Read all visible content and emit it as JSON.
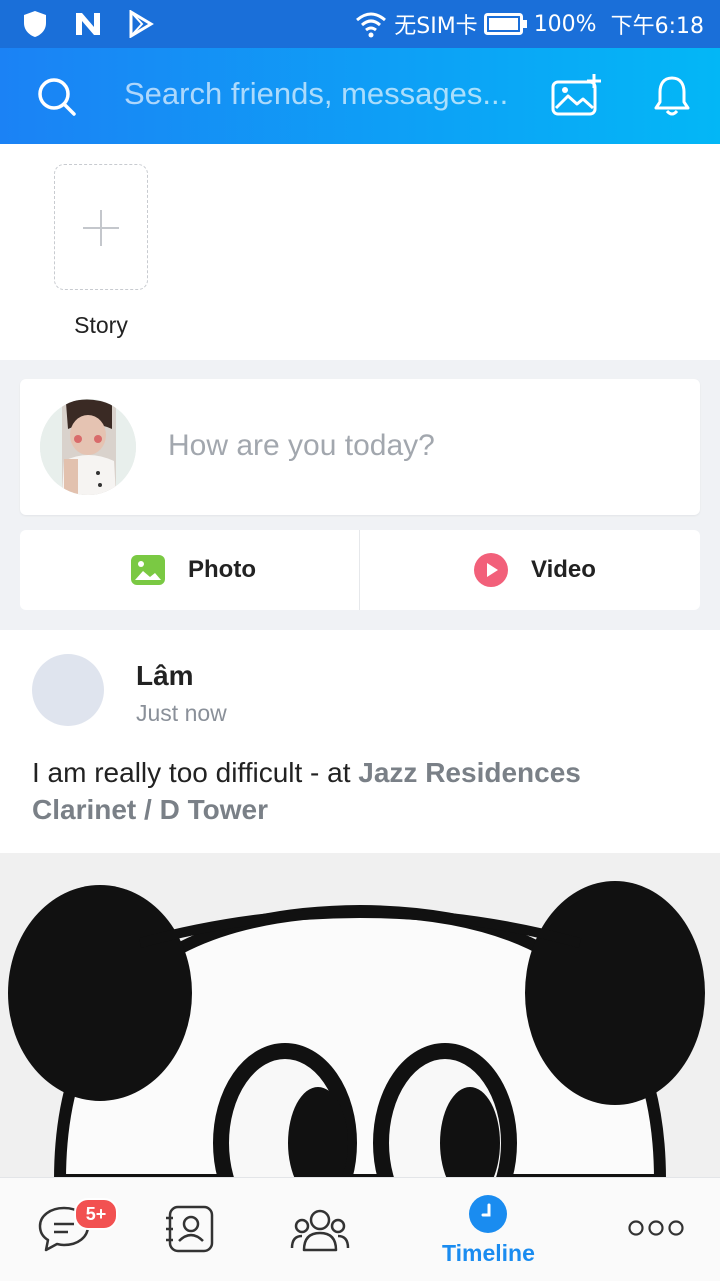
{
  "status_bar": {
    "carrier": "无SIM卡",
    "battery": "100%",
    "time": "下午6:18",
    "icons": [
      "shield-icon",
      "n-icon",
      "play-store-icon",
      "wifi-icon",
      "battery-icon"
    ]
  },
  "header": {
    "search_placeholder": "Search friends, messages...",
    "icons": [
      "search-icon",
      "add-photo-icon",
      "bell-icon"
    ]
  },
  "stories": {
    "add_label": "Story"
  },
  "composer": {
    "prompt": "How are you today?"
  },
  "media": {
    "photo_label": "Photo",
    "video_label": "Video"
  },
  "post": {
    "author": "Lâm",
    "time": "Just now",
    "text": "I am really too difficult - at ",
    "location": "Jazz Residences Clarinet / D Tower"
  },
  "bottom_nav": {
    "messages_badge": "5+",
    "active_tab": "Timeline",
    "items": [
      "messages-icon",
      "contacts-icon",
      "groups-icon",
      "timeline-icon",
      "more-icon"
    ]
  },
  "colors": {
    "header_start": "#1b82f5",
    "header_end": "#03b7f6",
    "accent": "#1a8cf0",
    "badge": "#f25151",
    "photo_icon": "#7ac943",
    "video_icon": "#f2607a"
  }
}
